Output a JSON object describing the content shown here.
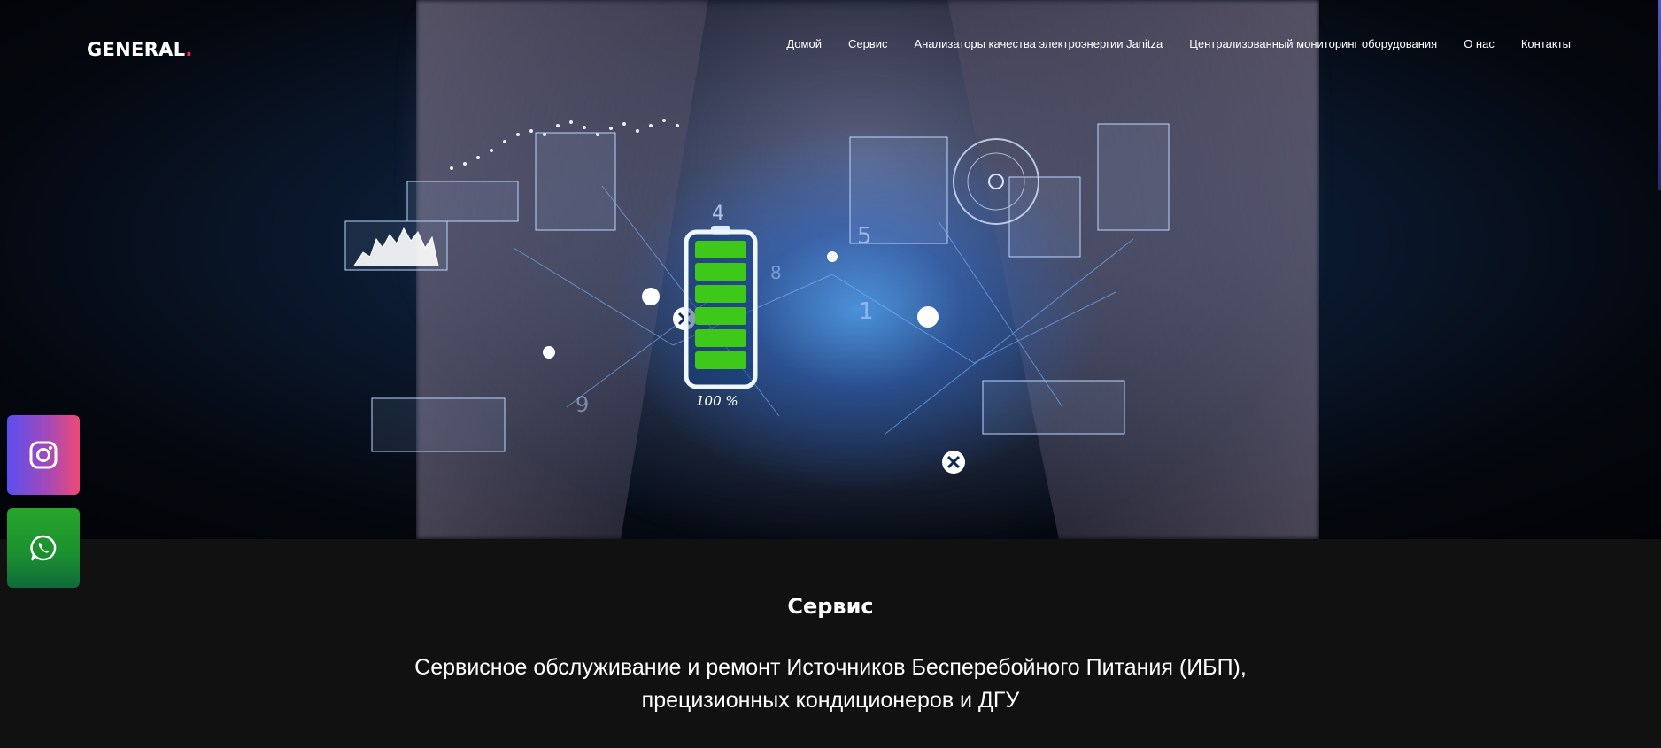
{
  "header": {
    "logo_text": "GENERAL",
    "logo_dot": ".",
    "nav": [
      {
        "label": "Домой"
      },
      {
        "label": "Сервис"
      },
      {
        "label": "Анализаторы качества электроэнергии Janitza"
      },
      {
        "label": "Централизованный мониторинг оборудования"
      },
      {
        "label": "О нас"
      },
      {
        "label": "Контакты"
      }
    ]
  },
  "hero": {
    "battery_label": "100 %",
    "battery_top_digit": "4",
    "hud_digits": [
      "5",
      "1",
      "9",
      "8"
    ]
  },
  "section": {
    "title": "Сервис",
    "text_line1": "Сервисное обслуживание и ремонт Источников Бесперебойного Питания (ИБП),",
    "text_line2": "прецизионных кондиционеров и ДГУ"
  },
  "social": [
    {
      "icon": "instagram-icon"
    },
    {
      "icon": "whatsapp-icon"
    }
  ],
  "colors": {
    "logo_dot": "#ff2a55",
    "content_bg": "#111111",
    "battery_fill": "#3ec81a",
    "instagram_gradient": [
      "#5a4ff0",
      "#ee4a76"
    ],
    "whatsapp_gradient": [
      "#27a52b",
      "#0f6a3a"
    ]
  }
}
